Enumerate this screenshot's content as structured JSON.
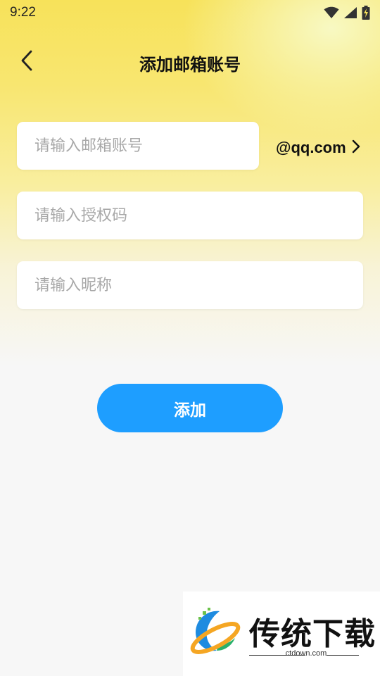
{
  "status_bar": {
    "time": "9:22",
    "icons": [
      "wifi-icon",
      "signal-icon",
      "battery-charging-icon"
    ]
  },
  "nav": {
    "title": "添加邮箱账号",
    "back_icon": "chevron-left-icon"
  },
  "form": {
    "email_placeholder": "请输入邮箱账号",
    "domain": "@qq.com",
    "domain_icon": "chevron-right-icon",
    "auth_code_placeholder": "请输入授权码",
    "nickname_placeholder": "请输入昵称",
    "submit_label": "添加"
  },
  "watermark": {
    "title": "传统下载",
    "url": "ctdown.com"
  },
  "colors": {
    "accent": "#1e9eff",
    "header_yellow": "#f7e25a",
    "background": "#f7f7f7"
  }
}
